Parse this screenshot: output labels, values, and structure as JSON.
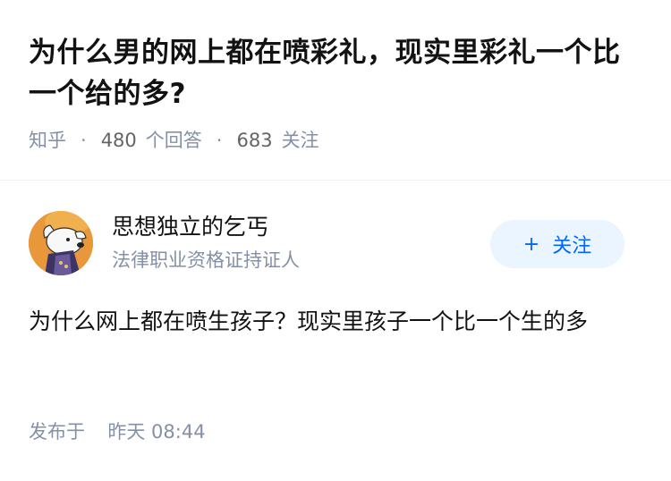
{
  "question": {
    "title": "为什么男的网上都在喷彩礼，现实里彩礼一个比一个给的多?",
    "source": "知乎",
    "answer_count": "480",
    "answer_label": "个回答",
    "follow_count": "683",
    "follow_label": "关注"
  },
  "author": {
    "name": "思想独立的乞丐",
    "badge": "法律职业资格证持证人",
    "avatar_icon": "dog-avatar-icon",
    "follow_button_label": "关注",
    "follow_button_icon": "+"
  },
  "answer": {
    "content": "为什么网上都在喷生孩子？现实里孩子一个比一个生的多",
    "published_label": "发布于",
    "published_time": "昨天 08:44"
  },
  "colors": {
    "accent": "#0066ff",
    "follow_bg": "#ebf5ff",
    "muted": "#8590a6",
    "text": "#121212"
  }
}
